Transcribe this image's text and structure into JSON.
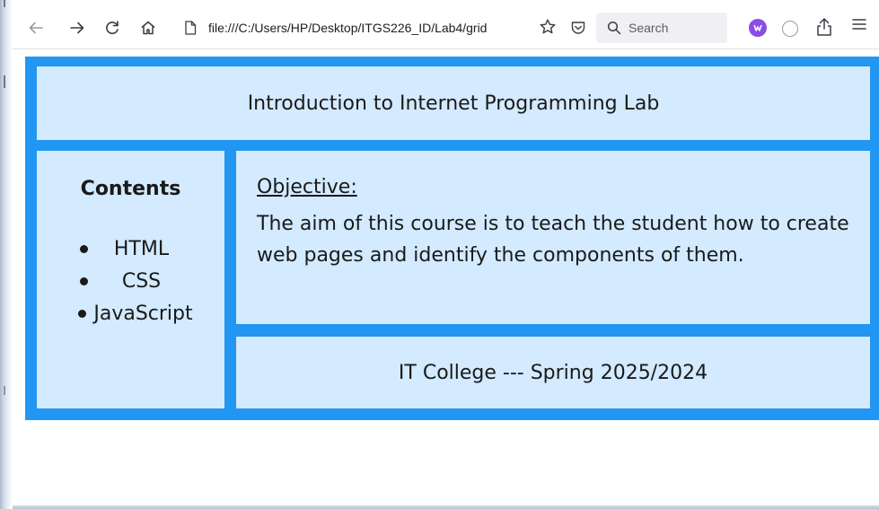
{
  "browser": {
    "url": "file:///C:/Users/HP/Desktop/ITGS226_ID/Lab4/grid",
    "search_placeholder": "Search",
    "icons": {
      "back": "back-arrow-icon",
      "forward": "forward-arrow-icon",
      "reload": "reload-icon",
      "home": "home-icon",
      "page": "page-icon",
      "bookmark": "star-icon",
      "pocket": "pocket-icon",
      "search": "search-icon",
      "extension1": "extension-icon",
      "extension2": "extension-icon",
      "share": "share-icon",
      "menu": "hamburger-menu-icon"
    }
  },
  "page": {
    "header": "Introduction to Internet Programming Lab",
    "sidebar": {
      "title": "Contents",
      "items": [
        "HTML",
        "CSS",
        "JavaScript"
      ]
    },
    "main": {
      "objective_label": "Objective:",
      "objective_text": "The aim of this course is to teach the student how to create web pages and identify the components of them."
    },
    "footer": "IT College --- Spring 2025/2024"
  },
  "colors": {
    "grid_background": "#2196f3",
    "cell_background": "#d3eaff",
    "text": "#1a1a1a"
  }
}
